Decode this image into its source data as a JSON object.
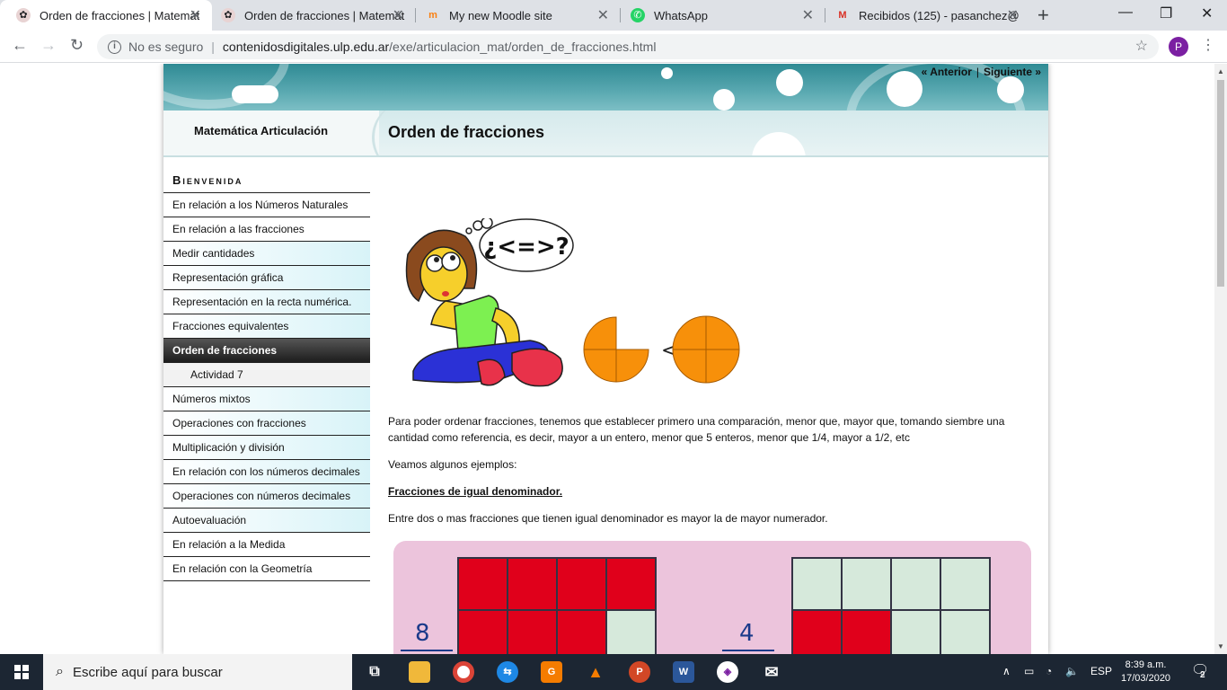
{
  "browser": {
    "tabs": [
      {
        "title": "Orden de fracciones | Matemát",
        "active": true
      },
      {
        "title": "Orden de fracciones | Matemát",
        "active": false
      },
      {
        "title": "My new Moodle site",
        "active": false
      },
      {
        "title": "WhatsApp",
        "active": false
      },
      {
        "title": "Recibidos (125) - pasanchez@",
        "active": false
      }
    ],
    "security_label": "No es seguro",
    "url_host": "contenidosdigitales.ulp.edu.ar",
    "url_path": "/exe/articulacion_mat/orden_de_fracciones.html",
    "profile_initial": "P"
  },
  "page": {
    "pager": {
      "prev": "« Anterior",
      "sep": "|",
      "next": "Siguiente »"
    },
    "project_title": "Matemática Articulación",
    "title": "Orden de fracciones",
    "sidebar": {
      "heading": "Bienvenida",
      "items": [
        "En relación a los Números Naturales",
        "En relación a las fracciones",
        "Medir cantidades",
        "Representación gráfica",
        "Representación en la recta numérica.",
        "Fracciones equivalentes",
        "Orden de fracciones",
        "Actividad 7",
        "Números mixtos",
        "Operaciones con fracciones",
        "Multiplicación y división",
        "En relación con los números decimales",
        "Operaciones con números decimales",
        "Autoevaluación",
        "En relación a la Medida",
        "En relación con la Geometría"
      ]
    },
    "illustration": {
      "thought": "¿<=>?",
      "compare_sign": "<"
    },
    "intro": "Para poder ordenar fracciones, tenemos que establecer primero una comparación, menor que, mayor que, tomando siembre una cantidad como referencia, es decir, mayor a un entero, menor que 5 enteros, menor que 1/4, mayor a 1/2, etc",
    "examples_intro": "Veamos algunos ejemplos:",
    "section_heading": "Fracciones de igual denominador.",
    "section_text": "Entre dos o mas fracciones que tienen igual denominador es mayor la de mayor numerador.",
    "figure": {
      "left_numerator": "8",
      "right_numerator": "4"
    }
  },
  "taskbar": {
    "search_placeholder": "Escribe aquí para buscar",
    "language": "ESP",
    "time": "8:39 a.m.",
    "date": "17/03/2020",
    "notifications": "2"
  }
}
